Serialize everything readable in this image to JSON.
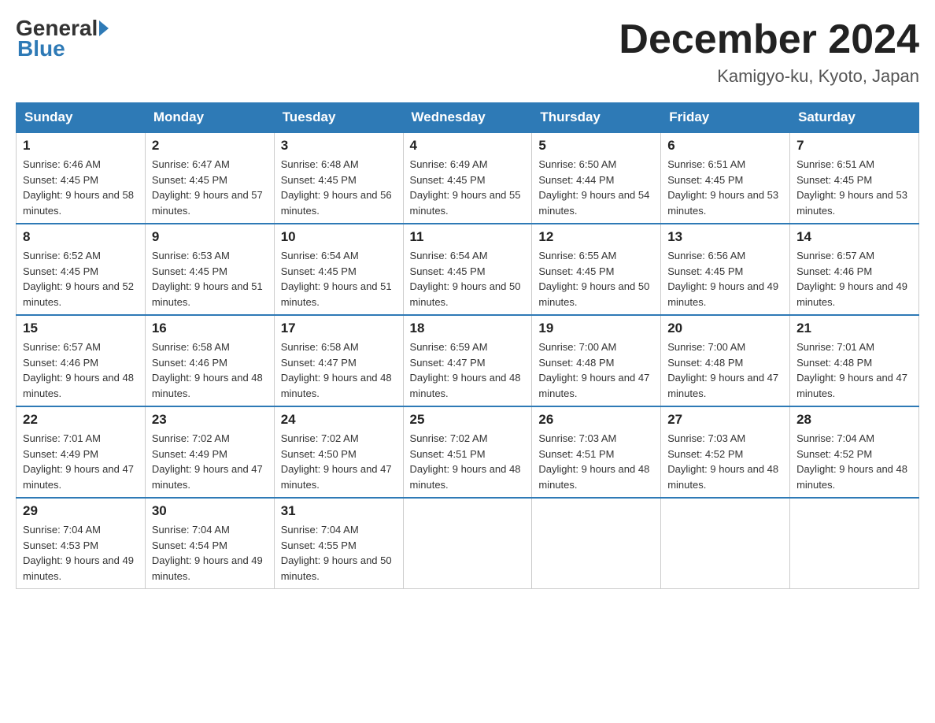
{
  "header": {
    "logo_general": "General",
    "logo_blue": "Blue",
    "month_title": "December 2024",
    "location": "Kamigyo-ku, Kyoto, Japan"
  },
  "weekdays": [
    "Sunday",
    "Monday",
    "Tuesday",
    "Wednesday",
    "Thursday",
    "Friday",
    "Saturday"
  ],
  "weeks": [
    [
      {
        "day": "1",
        "sunrise": "6:46 AM",
        "sunset": "4:45 PM",
        "daylight": "9 hours and 58 minutes."
      },
      {
        "day": "2",
        "sunrise": "6:47 AM",
        "sunset": "4:45 PM",
        "daylight": "9 hours and 57 minutes."
      },
      {
        "day": "3",
        "sunrise": "6:48 AM",
        "sunset": "4:45 PM",
        "daylight": "9 hours and 56 minutes."
      },
      {
        "day": "4",
        "sunrise": "6:49 AM",
        "sunset": "4:45 PM",
        "daylight": "9 hours and 55 minutes."
      },
      {
        "day": "5",
        "sunrise": "6:50 AM",
        "sunset": "4:44 PM",
        "daylight": "9 hours and 54 minutes."
      },
      {
        "day": "6",
        "sunrise": "6:51 AM",
        "sunset": "4:45 PM",
        "daylight": "9 hours and 53 minutes."
      },
      {
        "day": "7",
        "sunrise": "6:51 AM",
        "sunset": "4:45 PM",
        "daylight": "9 hours and 53 minutes."
      }
    ],
    [
      {
        "day": "8",
        "sunrise": "6:52 AM",
        "sunset": "4:45 PM",
        "daylight": "9 hours and 52 minutes."
      },
      {
        "day": "9",
        "sunrise": "6:53 AM",
        "sunset": "4:45 PM",
        "daylight": "9 hours and 51 minutes."
      },
      {
        "day": "10",
        "sunrise": "6:54 AM",
        "sunset": "4:45 PM",
        "daylight": "9 hours and 51 minutes."
      },
      {
        "day": "11",
        "sunrise": "6:54 AM",
        "sunset": "4:45 PM",
        "daylight": "9 hours and 50 minutes."
      },
      {
        "day": "12",
        "sunrise": "6:55 AM",
        "sunset": "4:45 PM",
        "daylight": "9 hours and 50 minutes."
      },
      {
        "day": "13",
        "sunrise": "6:56 AM",
        "sunset": "4:45 PM",
        "daylight": "9 hours and 49 minutes."
      },
      {
        "day": "14",
        "sunrise": "6:57 AM",
        "sunset": "4:46 PM",
        "daylight": "9 hours and 49 minutes."
      }
    ],
    [
      {
        "day": "15",
        "sunrise": "6:57 AM",
        "sunset": "4:46 PM",
        "daylight": "9 hours and 48 minutes."
      },
      {
        "day": "16",
        "sunrise": "6:58 AM",
        "sunset": "4:46 PM",
        "daylight": "9 hours and 48 minutes."
      },
      {
        "day": "17",
        "sunrise": "6:58 AM",
        "sunset": "4:47 PM",
        "daylight": "9 hours and 48 minutes."
      },
      {
        "day": "18",
        "sunrise": "6:59 AM",
        "sunset": "4:47 PM",
        "daylight": "9 hours and 48 minutes."
      },
      {
        "day": "19",
        "sunrise": "7:00 AM",
        "sunset": "4:48 PM",
        "daylight": "9 hours and 47 minutes."
      },
      {
        "day": "20",
        "sunrise": "7:00 AM",
        "sunset": "4:48 PM",
        "daylight": "9 hours and 47 minutes."
      },
      {
        "day": "21",
        "sunrise": "7:01 AM",
        "sunset": "4:48 PM",
        "daylight": "9 hours and 47 minutes."
      }
    ],
    [
      {
        "day": "22",
        "sunrise": "7:01 AM",
        "sunset": "4:49 PM",
        "daylight": "9 hours and 47 minutes."
      },
      {
        "day": "23",
        "sunrise": "7:02 AM",
        "sunset": "4:49 PM",
        "daylight": "9 hours and 47 minutes."
      },
      {
        "day": "24",
        "sunrise": "7:02 AM",
        "sunset": "4:50 PM",
        "daylight": "9 hours and 47 minutes."
      },
      {
        "day": "25",
        "sunrise": "7:02 AM",
        "sunset": "4:51 PM",
        "daylight": "9 hours and 48 minutes."
      },
      {
        "day": "26",
        "sunrise": "7:03 AM",
        "sunset": "4:51 PM",
        "daylight": "9 hours and 48 minutes."
      },
      {
        "day": "27",
        "sunrise": "7:03 AM",
        "sunset": "4:52 PM",
        "daylight": "9 hours and 48 minutes."
      },
      {
        "day": "28",
        "sunrise": "7:04 AM",
        "sunset": "4:52 PM",
        "daylight": "9 hours and 48 minutes."
      }
    ],
    [
      {
        "day": "29",
        "sunrise": "7:04 AM",
        "sunset": "4:53 PM",
        "daylight": "9 hours and 49 minutes."
      },
      {
        "day": "30",
        "sunrise": "7:04 AM",
        "sunset": "4:54 PM",
        "daylight": "9 hours and 49 minutes."
      },
      {
        "day": "31",
        "sunrise": "7:04 AM",
        "sunset": "4:55 PM",
        "daylight": "9 hours and 50 minutes."
      },
      null,
      null,
      null,
      null
    ]
  ],
  "labels": {
    "sunrise": "Sunrise: ",
    "sunset": "Sunset: ",
    "daylight": "Daylight: "
  }
}
